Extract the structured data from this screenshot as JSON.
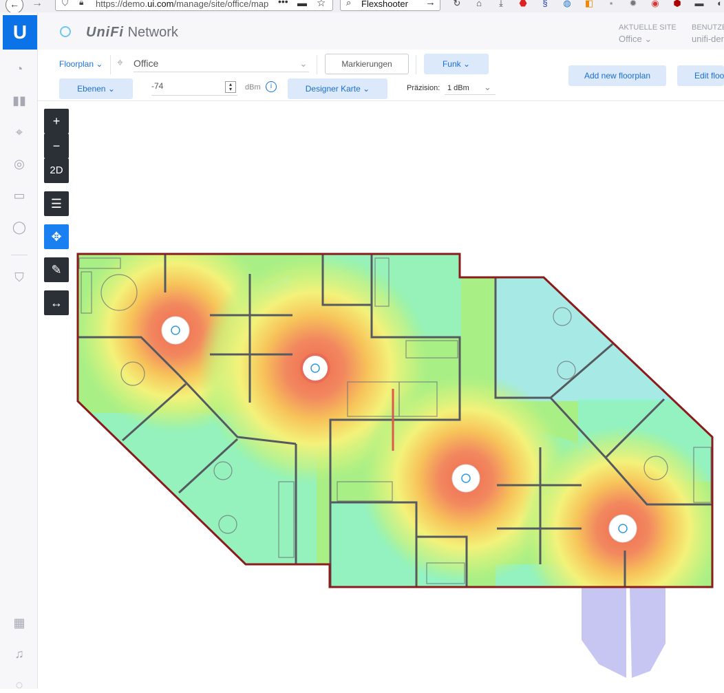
{
  "browser": {
    "url_prefix": "https://demo.",
    "url_domain": "ui.com",
    "url_suffix": "/manage/site/office/map",
    "search_text": "Flexshooter",
    "back_icon": "back-arrow-icon",
    "forward_icon": "forward-arrow-icon"
  },
  "app": {
    "logo_letter": "U",
    "brand_prefix": "UniFi",
    "brand_suffix": "Network",
    "accent": "#0b72e7"
  },
  "header": {
    "site_label": "AKTUELLE SITE",
    "site_value": "Office",
    "user_label": "BENUTZER",
    "user_value": "unifi-demo"
  },
  "toolbar": {
    "floorplan_label": "Floorplan",
    "floorplan_select": "Office",
    "markers_button": "Markierungen",
    "radio_button": "Funk",
    "layers_button": "Ebenen",
    "signal_value": "-74",
    "signal_unit": "dBm",
    "designer_button": "Designer Karte",
    "precision_label": "Präzision:",
    "precision_value": "1 dBm",
    "add_floorplan_button": "Add new floorplan",
    "edit_floorplan_button": "Edit floorplan"
  },
  "map_tools": {
    "zoom_in": "+",
    "zoom_out": "−",
    "view_mode": "2D"
  },
  "heatmap": {
    "colors": {
      "strong": "#f2885f",
      "good": "#f7c45a",
      "medium": "#f3f27a",
      "weak": "#a8ef86",
      "low": "#8ff3cf",
      "very_low": "#a7e7f4",
      "wall": "#8b1a1a",
      "inner_wall": "#555a60",
      "outdoor_zone": "#c7c6f3"
    },
    "access_points": [
      "ap-1",
      "ap-2",
      "ap-3",
      "ap-4"
    ]
  }
}
